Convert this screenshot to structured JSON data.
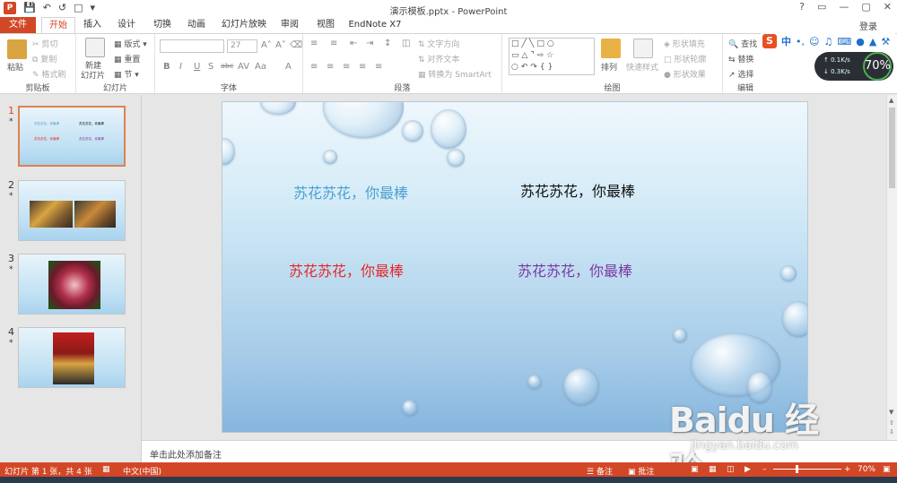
{
  "window": {
    "title": "演示模板.pptx - PowerPoint",
    "app_logo": "P",
    "controls": [
      "?",
      "▭",
      "—",
      "▢",
      "✕"
    ],
    "login": "登录"
  },
  "tabs": [
    "文件",
    "开始",
    "插入",
    "设计",
    "切换",
    "动画",
    "幻灯片放映",
    "审阅",
    "视图",
    "EndNote X7"
  ],
  "ribbon": {
    "clipboard": {
      "label": "剪贴板",
      "paste": "粘贴",
      "cut": "剪切",
      "copy": "复制",
      "format_painter": "格式刷"
    },
    "slides": {
      "label": "幻灯片",
      "new_slide": "新建",
      "new_slide2": "幻灯片",
      "layout": "版式",
      "reset": "重置",
      "section": "节"
    },
    "font": {
      "label": "字体",
      "font_name": "",
      "font_size": "27",
      "buttons": [
        "B",
        "I",
        "U",
        "S",
        "abc",
        "AV",
        "Aa",
        "A"
      ]
    },
    "paragraph": {
      "label": "段落",
      "text_direction": "文字方向",
      "align_text": "对齐文本",
      "smartart": "转换为 SmartArt"
    },
    "drawing": {
      "label": "绘图",
      "arrange": "排列",
      "quick_styles": "快速样式",
      "shape_fill": "形状填充",
      "shape_outline": "形状轮廓",
      "shape_effects": "形状效果"
    },
    "editing": {
      "label": "编辑",
      "find": "查找",
      "replace": "替换",
      "select": "选择"
    }
  },
  "ime_bar": {
    "logo": "S",
    "mode": "中"
  },
  "speed": {
    "up": "0.1K/s",
    "down": "0.3K/s",
    "percent": "70%"
  },
  "slides": [
    {
      "num": "1",
      "star": "*"
    },
    {
      "num": "2",
      "star": "*"
    },
    {
      "num": "3",
      "star": "*"
    },
    {
      "num": "4",
      "star": "*"
    }
  ],
  "slide": {
    "texts": [
      {
        "text": "苏花苏花，你最棒",
        "color": "#4a9fd0"
      },
      {
        "text": "苏花苏花，你最棒",
        "color": "#111111"
      },
      {
        "text": "苏花苏花，你最棒",
        "color": "#e3282a"
      },
      {
        "text": "苏花苏花，你最棒",
        "color": "#7a3aa3"
      }
    ]
  },
  "notes_placeholder": "单击此处添加备注",
  "status": {
    "slide_info": "幻灯片 第 1 张，共 4 张",
    "language": "中文(中国)",
    "notes": "备注",
    "comments": "批注",
    "zoom": "70%"
  },
  "watermark": {
    "main": "Baidu 经验",
    "sub": "jingyan.baidu.com"
  },
  "colors": {
    "accent": "#d24726"
  }
}
